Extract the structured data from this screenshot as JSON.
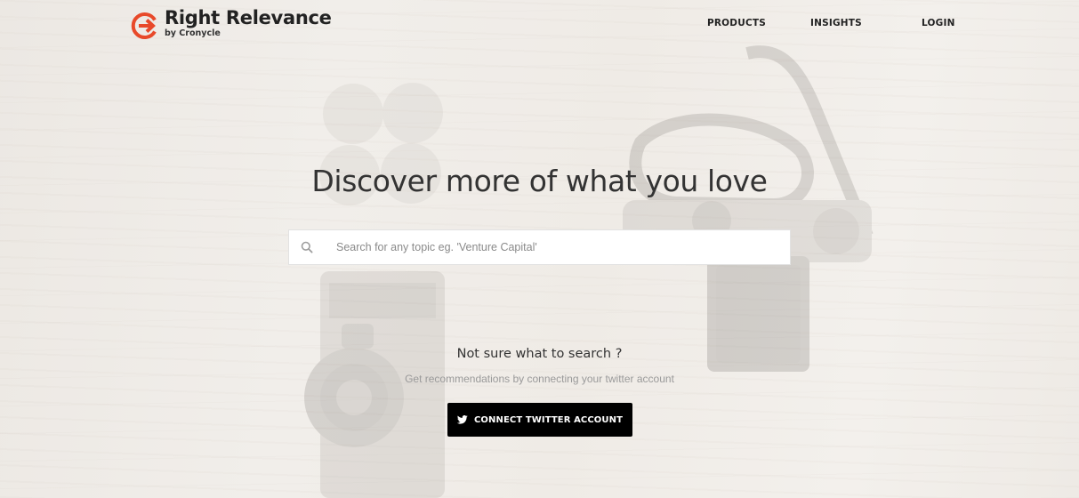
{
  "brand": {
    "name": "Right Relevance",
    "tagline": "by Cronycle",
    "logo_icon": "right-relevance-logo-icon",
    "accent_color": "#e8492a"
  },
  "nav": {
    "items": [
      {
        "label": "PRODUCTS"
      },
      {
        "label": "INSIGHTS"
      },
      {
        "label": "LOGIN"
      }
    ]
  },
  "hero": {
    "headline": "Discover more of what you love",
    "search": {
      "icon": "search-icon",
      "placeholder": "Search for any topic eg. 'Venture Capital'",
      "value": ""
    }
  },
  "recommend": {
    "heading": "Not sure what to search ?",
    "subtext": "Get recommendations by connecting your twitter account",
    "button_label": "CONNECT TWITTER ACCOUNT",
    "button_icon": "twitter-icon",
    "button_color": "#000000"
  }
}
